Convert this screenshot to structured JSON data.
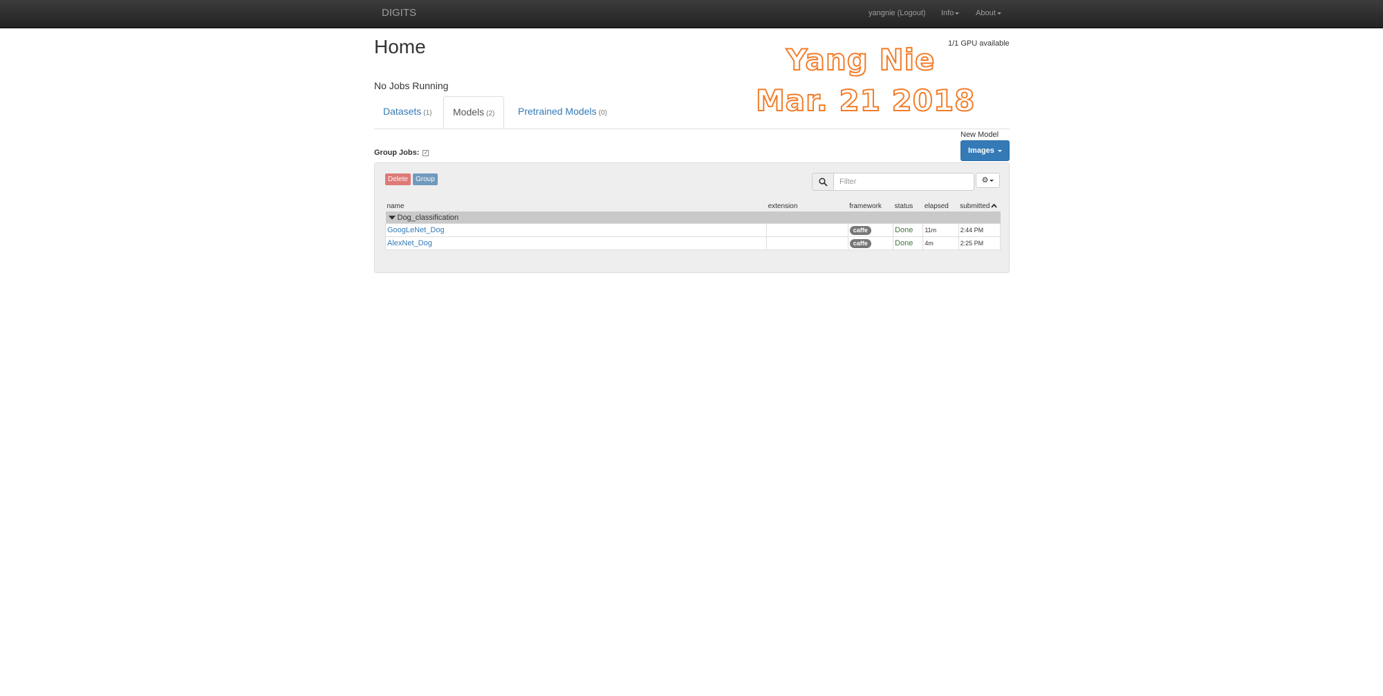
{
  "navbar": {
    "brand": "DIGITS",
    "user": "yangnie (Logout)",
    "info": "Info",
    "about": "About"
  },
  "page": {
    "title": "Home",
    "gpu_status": "1/1 GPU available",
    "jobs_status": "No Jobs Running"
  },
  "watermark": {
    "name": "Yang Nie",
    "date": "Mar. 21 2018"
  },
  "tabs": [
    {
      "label": "Datasets",
      "count": "(1)",
      "active": false
    },
    {
      "label": "Models",
      "count": "(2)",
      "active": true
    },
    {
      "label": "Pretrained Models",
      "count": "(0)",
      "active": false
    }
  ],
  "group_jobs": {
    "label": "Group Jobs:",
    "checked": true
  },
  "new_model": {
    "label": "New Model",
    "button": "Images"
  },
  "toolbar": {
    "delete_label": "Delete",
    "group_label": "Group",
    "filter_placeholder": "Filter"
  },
  "table": {
    "columns": [
      "name",
      "extension",
      "framework",
      "status",
      "elapsed",
      "submitted"
    ],
    "group_name": "Dog_classification",
    "rows": [
      {
        "name": "GoogLeNet_Dog",
        "extension": "",
        "framework": "caffe",
        "status": "Done",
        "elapsed": "11m",
        "submitted": "2:44 PM"
      },
      {
        "name": "AlexNet_Dog",
        "extension": "",
        "framework": "caffe",
        "status": "Done",
        "elapsed": "4m",
        "submitted": "2:25 PM"
      }
    ]
  },
  "colors": {
    "navbar": "#222222",
    "link": "#337ab7",
    "primary_button": "#337ab7",
    "delete_button": "#d9534f",
    "status_done": "#3c763d",
    "watermark_outline": "#f27c28"
  }
}
